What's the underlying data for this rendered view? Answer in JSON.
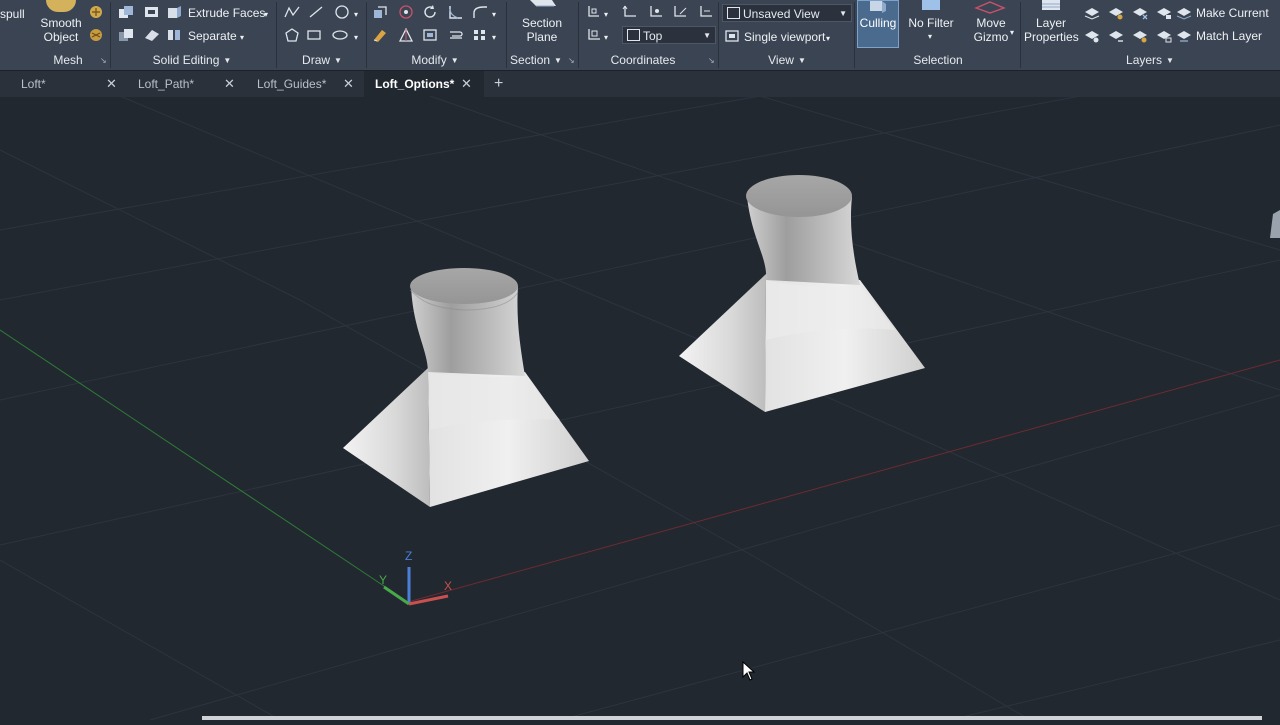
{
  "ribbon": {
    "presspull_label": "spull",
    "smooth_object_label": "Smooth\nObject",
    "extrude_faces_label": "Extrude Faces",
    "separate_label": "Separate",
    "section_plane_label": "Section\nPlane",
    "named_view_value": "Unsaved View",
    "ucs_value": "Top",
    "viewport_config_label": "Single viewport",
    "culling_label": "Culling",
    "no_filter_label": "No Filter",
    "move_gizmo_label": "Move\nGizmo",
    "layer_properties_label": "Layer\nProperties",
    "make_current_label": "Make Current",
    "match_layer_label": "Match Layer"
  },
  "panels": {
    "mesh": "Mesh",
    "solid_editing": "Solid Editing",
    "draw": "Draw",
    "modify": "Modify",
    "section": "Section",
    "coordinates": "Coordinates",
    "view": "View",
    "selection": "Selection",
    "layers": "Layers"
  },
  "tabs": [
    {
      "label": "Loft*",
      "active": false
    },
    {
      "label": "Loft_Path*",
      "active": false
    },
    {
      "label": "Loft_Guides*",
      "active": false
    },
    {
      "label": "Loft_Options*",
      "active": true
    }
  ],
  "tab_close_glyph": "✕",
  "new_tab_glyph": "+",
  "ucs_icon": {
    "x_label": "X",
    "y_label": "Y",
    "z_label": "Z"
  },
  "colors": {
    "ribbon_bg": "#3b4453",
    "viewport_bg": "#212830",
    "x_axis": "#c8504f",
    "y_axis": "#4aa84a",
    "z_axis": "#4a7fd8"
  }
}
